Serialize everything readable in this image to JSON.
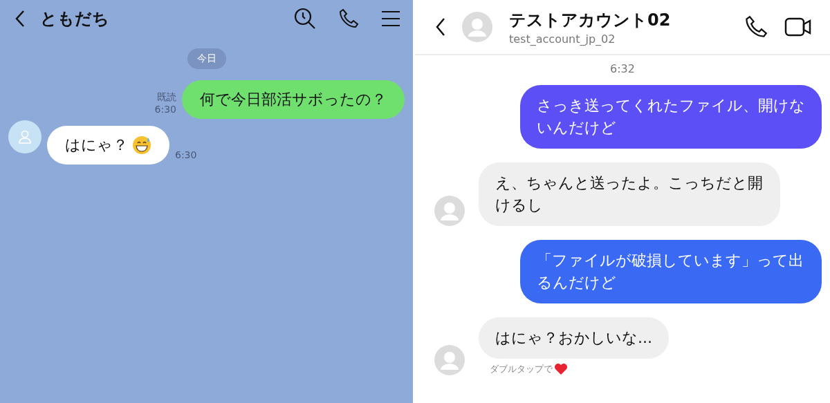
{
  "left_chat": {
    "header": {
      "title": "ともだち"
    },
    "date_label": "今日",
    "messages": [
      {
        "kind": "outgoing",
        "text": "何で今日部活サボったの？",
        "read_label": "既読",
        "time": "6:30"
      },
      {
        "kind": "incoming",
        "text": "はにゃ？",
        "emoji": true,
        "time": "6:30"
      }
    ]
  },
  "right_chat": {
    "header": {
      "name": "テストアカウント02",
      "username": "test_account_jp_02"
    },
    "time_label": "6:32",
    "messages": [
      {
        "kind": "outgoing",
        "text": "さっき送ってくれたファイル、開けないんだけど",
        "color": "#5b4ff5"
      },
      {
        "kind": "incoming",
        "text": "え、ちゃんと送ったよ。こっちだと開けるし"
      },
      {
        "kind": "outgoing",
        "text": "「ファイルが破損しています」って出るんだけど",
        "color": "#3a6af3"
      },
      {
        "kind": "incoming",
        "text": "はにゃ？おかしいな...",
        "hint": "ダブルタップで"
      }
    ]
  }
}
